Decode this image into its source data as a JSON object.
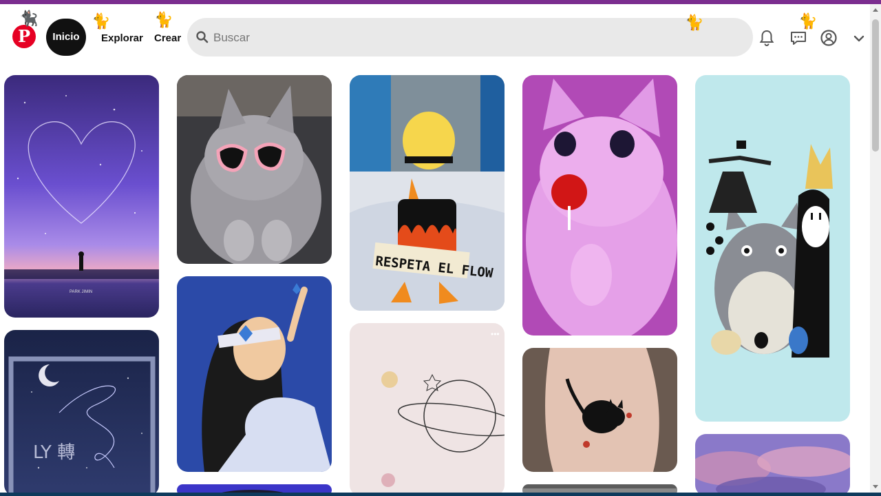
{
  "header": {
    "logo_label": "P",
    "nav": {
      "home": "Inicio",
      "explore": "Explorar",
      "create": "Crear"
    },
    "search": {
      "placeholder": "Buscar",
      "value": ""
    },
    "icons": [
      "notifications-icon",
      "messages-icon",
      "profile-icon",
      "chevron-down-icon"
    ]
  },
  "pins": [
    {
      "id": "galaxy-heart",
      "text": "PARK JIMIN"
    },
    {
      "id": "cat-sunglasses"
    },
    {
      "id": "duck-flow",
      "text": "RESPETA EL FLOW"
    },
    {
      "id": "pink-cat-lollipop"
    },
    {
      "id": "ghibli-characters"
    },
    {
      "id": "bts-constellation",
      "text": "LY 轉"
    },
    {
      "id": "butterfly-girl"
    },
    {
      "id": "planet-doodle"
    },
    {
      "id": "cat-tattoo"
    },
    {
      "id": "purple-clouds"
    }
  ],
  "colors": {
    "brand": "#e60023",
    "accent_bar": "#7b2d8f",
    "search_bg": "#e9e9e9"
  }
}
